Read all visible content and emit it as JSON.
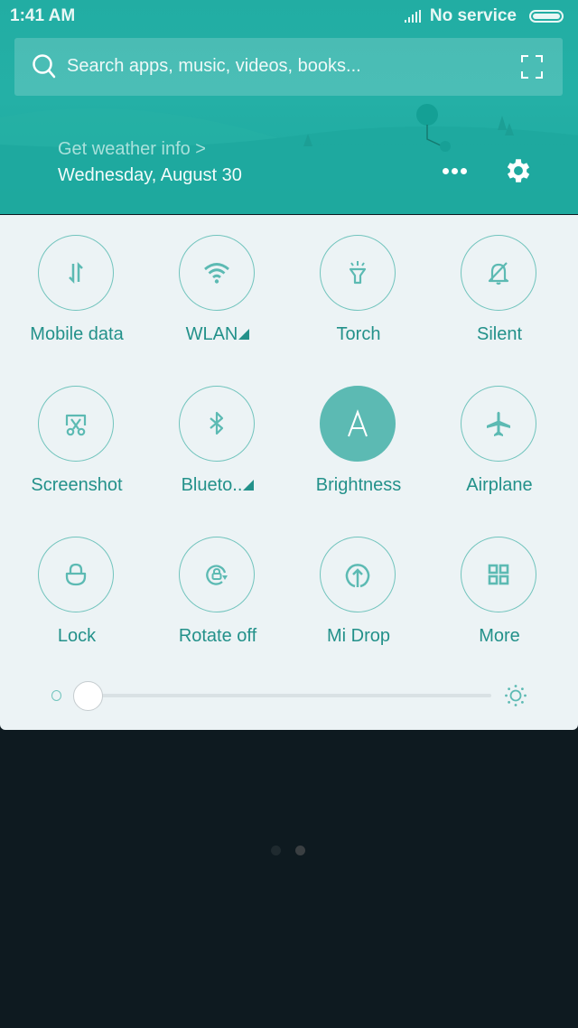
{
  "status_bar": {
    "time": "1:41 AM",
    "service": "No service",
    "signal_icon": "signal-bars-icon",
    "battery_icon": "battery-icon"
  },
  "search": {
    "placeholder": "Search apps, music, videos, books...",
    "search_icon": "search-icon",
    "scan_icon": "scan-icon"
  },
  "weather": {
    "link_text": "Get weather info >",
    "date": "Wednesday, August 30"
  },
  "header_actions": {
    "more_icon": "more-dots-icon",
    "settings_icon": "gear-icon"
  },
  "colors": {
    "header_teal": "#22ada3",
    "accent": "#5cbab3",
    "label_teal": "#23918a",
    "panel_bg": "#ecf3f5",
    "background": "#0e1a20"
  },
  "toggles": [
    {
      "label": "Mobile data",
      "icon": "mobile-data-icon",
      "active": false,
      "has_submenu": false
    },
    {
      "label": "WLAN",
      "icon": "wifi-icon",
      "active": false,
      "has_submenu": true
    },
    {
      "label": "Torch",
      "icon": "torch-icon",
      "active": false,
      "has_submenu": false
    },
    {
      "label": "Silent",
      "icon": "silent-bell-icon",
      "active": false,
      "has_submenu": false
    },
    {
      "label": "Screenshot",
      "icon": "screenshot-scissors-icon",
      "active": false,
      "has_submenu": false
    },
    {
      "label": "Blueto..",
      "icon": "bluetooth-icon",
      "active": false,
      "has_submenu": true
    },
    {
      "label": "Brightness",
      "icon": "auto-brightness-icon",
      "active": true,
      "has_submenu": false,
      "glyph": "A"
    },
    {
      "label": "Airplane",
      "icon": "airplane-icon",
      "active": false,
      "has_submenu": false
    },
    {
      "label": "Lock",
      "icon": "lock-icon",
      "active": false,
      "has_submenu": false
    },
    {
      "label": "Rotate off",
      "icon": "rotate-lock-icon",
      "active": false,
      "has_submenu": false
    },
    {
      "label": "Mi Drop",
      "icon": "mi-drop-icon",
      "active": false,
      "has_submenu": false
    },
    {
      "label": "More",
      "icon": "grid-icon",
      "active": false,
      "has_submenu": false
    }
  ],
  "brightness_slider": {
    "value_percent": 0,
    "min_icon": "brightness-low-icon",
    "max_icon": "brightness-high-icon"
  },
  "pager": {
    "page_count": 2,
    "current_page": 2
  }
}
